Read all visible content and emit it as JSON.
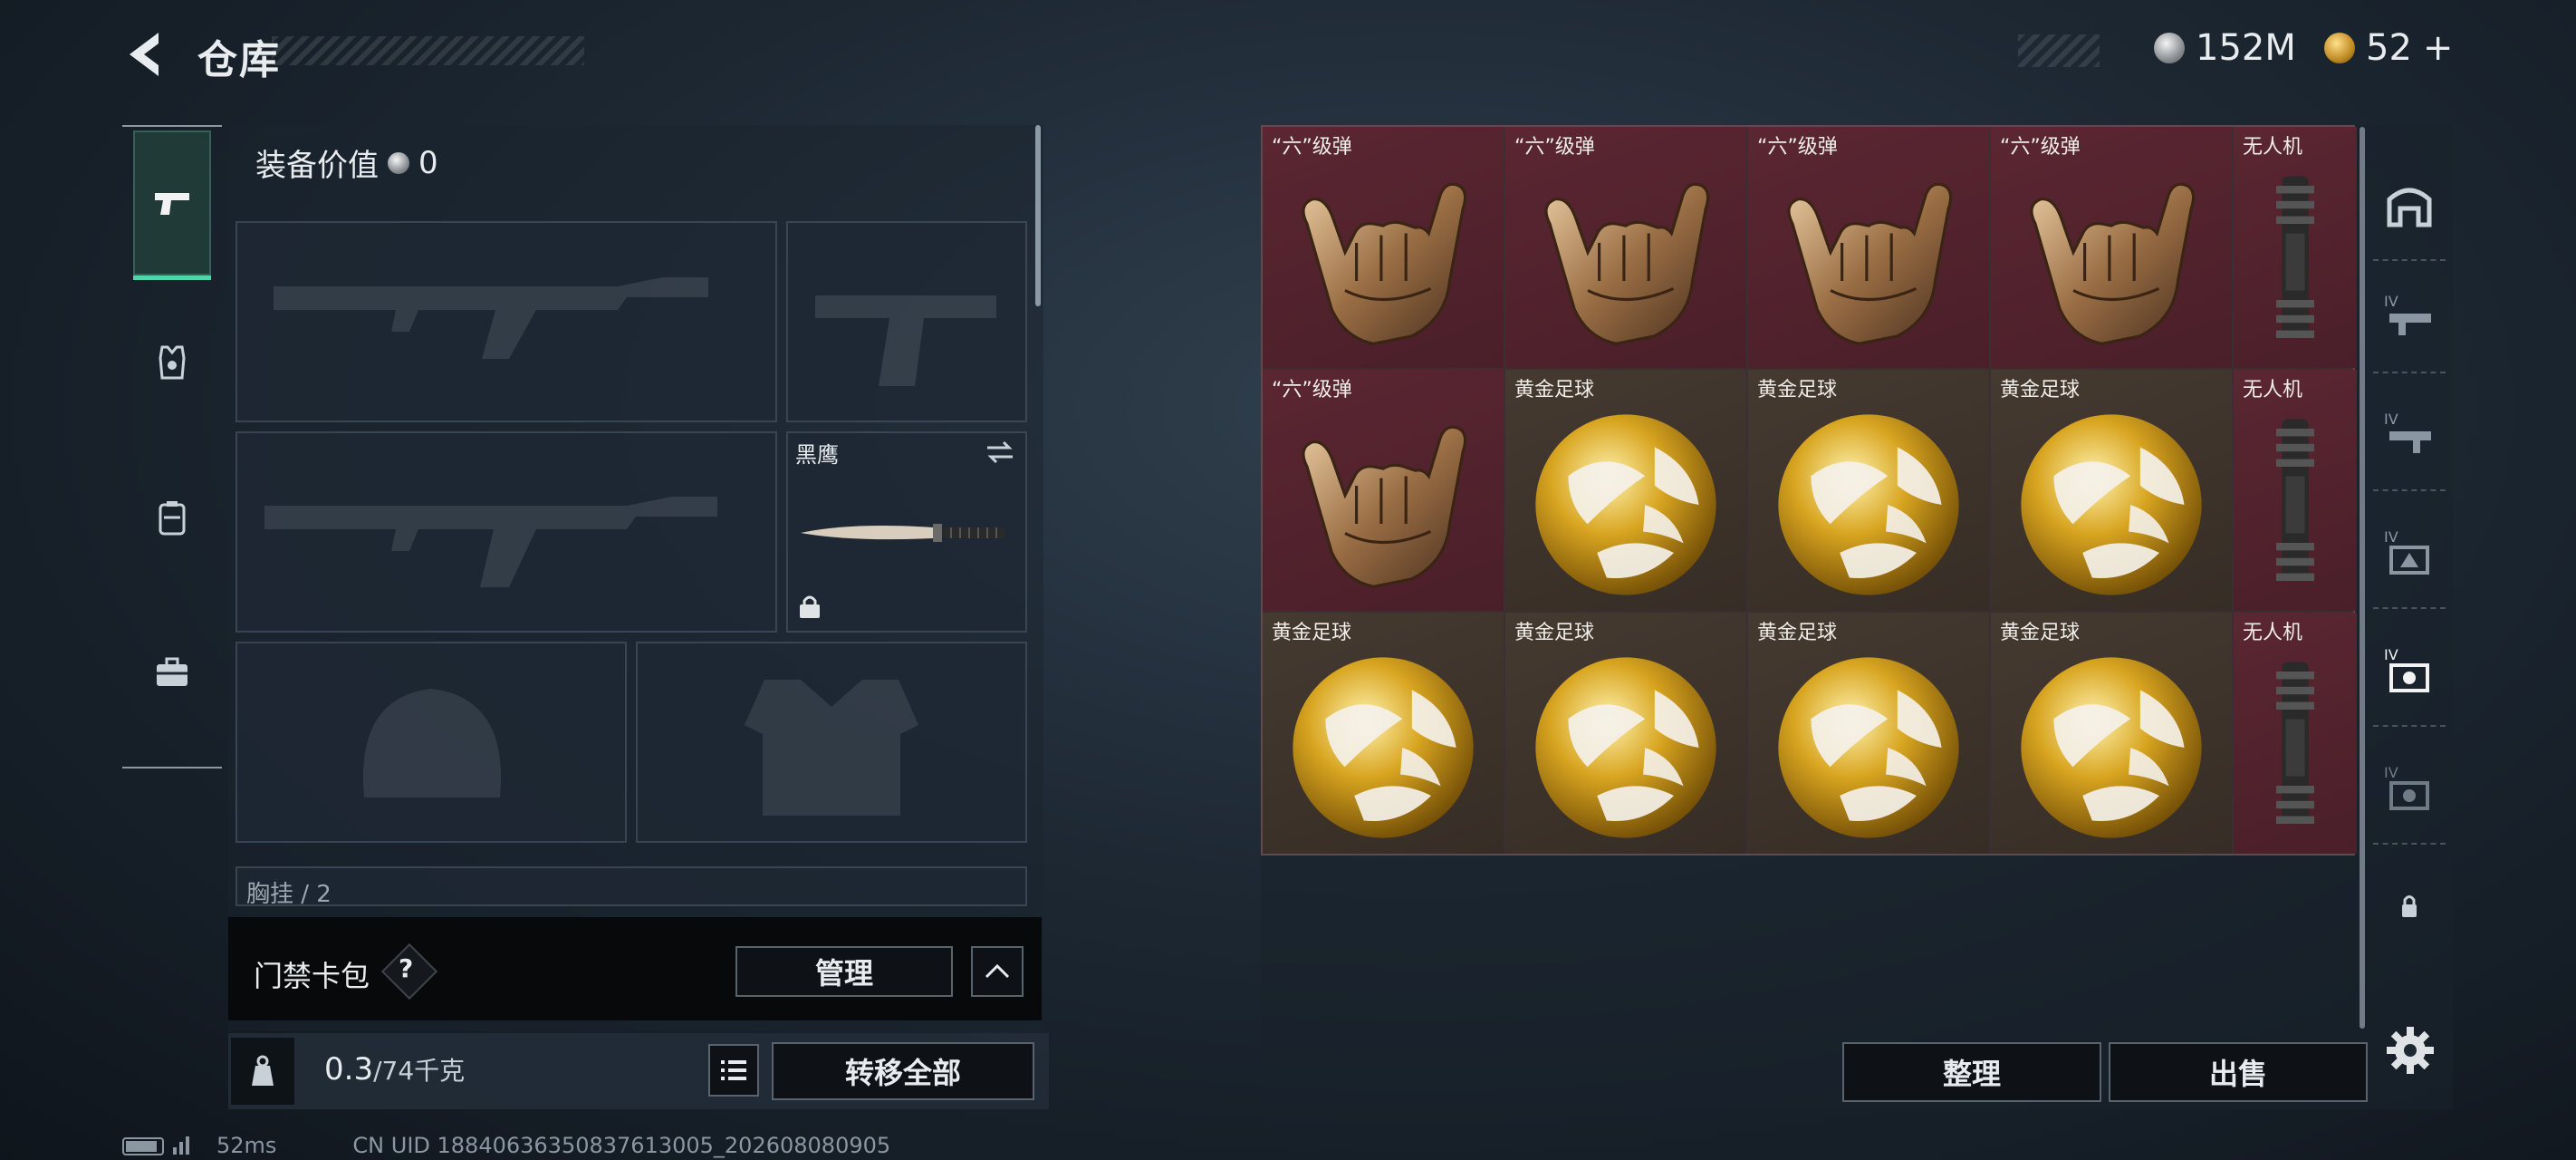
{
  "header": {
    "title": "仓库",
    "currency_a": "152M",
    "currency_b": "52",
    "currency_b_plus": "+"
  },
  "loadout": {
    "equipment_value_label": "装备价值",
    "equipment_value": "0",
    "knife_name": "黑鹰",
    "chest_label": "胸挂 / 2"
  },
  "access_card": {
    "label": "门禁卡包",
    "help": "?",
    "manage_label": "管理"
  },
  "capacity": {
    "current": "0.3",
    "max": "/74千克",
    "transfer_all_label": "转移全部"
  },
  "status": {
    "ping": "52ms",
    "uid": "CN UID 18840636350837613005_202608080905"
  },
  "storage": {
    "cells": [
      {
        "label": "“六”级弹",
        "item": "hand-sign",
        "bg": "red"
      },
      {
        "label": "“六”级弹",
        "item": "hand-sign",
        "bg": "red"
      },
      {
        "label": "“六”级弹",
        "item": "hand-sign",
        "bg": "red"
      },
      {
        "label": "“六”级弹",
        "item": "hand-sign",
        "bg": "red"
      },
      {
        "label": "无人机",
        "item": "drone-part",
        "bg": "red"
      },
      {
        "label": "“六”级弹",
        "item": "hand-sign",
        "bg": "red"
      },
      {
        "label": "黄金足球",
        "item": "gold-ball",
        "bg": "brown"
      },
      {
        "label": "黄金足球",
        "item": "gold-ball",
        "bg": "brown"
      },
      {
        "label": "黄金足球",
        "item": "gold-ball",
        "bg": "brown"
      },
      {
        "label": "无人机",
        "item": "drone-part",
        "bg": "red"
      },
      {
        "label": "黄金足球",
        "item": "gold-ball",
        "bg": "brown"
      },
      {
        "label": "黄金足球",
        "item": "gold-ball",
        "bg": "brown"
      },
      {
        "label": "黄金足球",
        "item": "gold-ball",
        "bg": "brown"
      },
      {
        "label": "黄金足球",
        "item": "gold-ball",
        "bg": "brown"
      },
      {
        "label": "无人机",
        "item": "drone-part",
        "bg": "red"
      }
    ],
    "sort_label": "整理",
    "sell_label": "出售",
    "tab_level_label": "IV"
  },
  "colors": {
    "accent": "#4dd6a8",
    "rare_red": "#4a1f29",
    "rare_brown": "#362d26"
  }
}
